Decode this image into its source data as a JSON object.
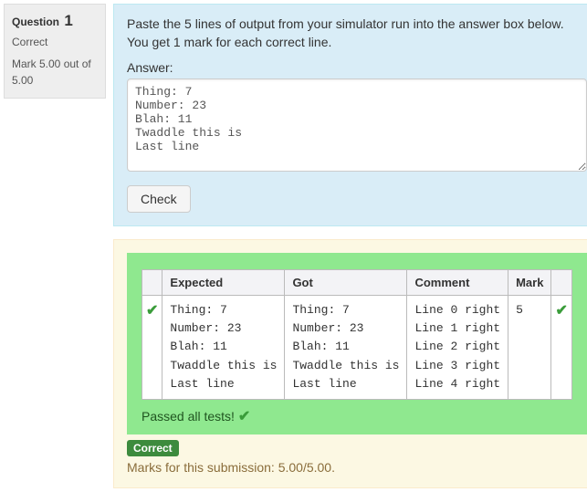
{
  "info": {
    "label": "Question",
    "number": "1",
    "state": "Correct",
    "mark_line": "Mark 5.00 out of 5.00"
  },
  "question": {
    "text": "Paste the 5 lines of output from your simulator run into the answer box below. You get 1 mark for each correct line.",
    "answer_label": "Answer:",
    "answer_value": "Thing: 7\nNumber: 23\nBlah: 11\nTwaddle this is\nLast line",
    "check_label": "Check"
  },
  "result": {
    "headers": {
      "expected": "Expected",
      "got": "Got",
      "comment": "Comment",
      "mark": "Mark"
    },
    "expected": "Thing: 7\nNumber: 23\nBlah: 11\nTwaddle this is\nLast line",
    "got": "Thing: 7\nNumber: 23\nBlah: 11\nTwaddle this is\nLast line",
    "comment": "Line 0 right\nLine 1 right\nLine 2 right\nLine 3 right\nLine 4 right",
    "mark": "5",
    "passed_msg": "Passed all tests!",
    "correct_pill": "Correct",
    "marks_msg": "Marks for this submission: 5.00/5.00."
  }
}
